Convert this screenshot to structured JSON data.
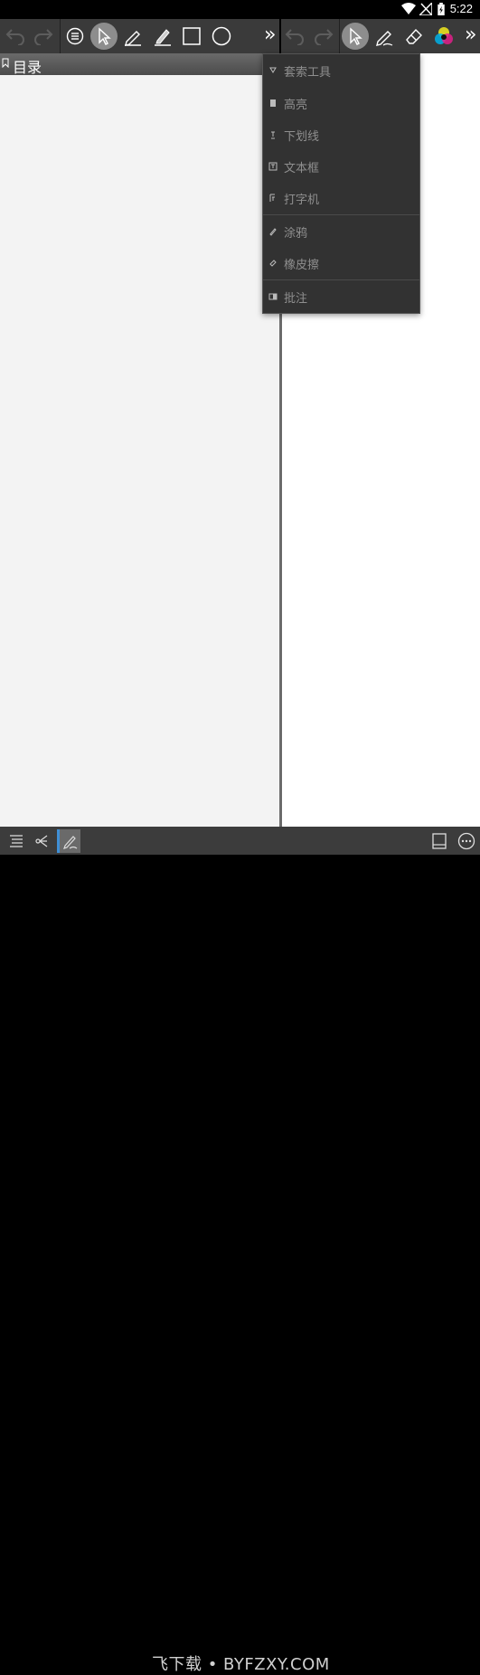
{
  "status_bar": {
    "time": "5:22"
  },
  "toc": {
    "title": "目录"
  },
  "annotation_menu": {
    "items": [
      {
        "label": "套索工具",
        "icon": "lasso-icon"
      },
      {
        "label": "高亮",
        "icon": "highlight-icon"
      },
      {
        "label": "下划线",
        "icon": "underline-icon"
      },
      {
        "label": "文本框",
        "icon": "textbox-icon"
      },
      {
        "label": "打字机",
        "icon": "typewriter-icon"
      },
      {
        "label": "涂鸦",
        "icon": "scribble-icon"
      },
      {
        "label": "橡皮擦",
        "icon": "eraser-icon"
      },
      {
        "label": "批注",
        "icon": "note-icon"
      }
    ]
  },
  "bottom_bar": {
    "watermark": "飞下载 • BYFZXY.COM"
  },
  "colors": {
    "toolbar": "#3a3a3a",
    "panel": "#f3f3f3",
    "menu": "#323232",
    "accent": "#3f8fd6"
  }
}
